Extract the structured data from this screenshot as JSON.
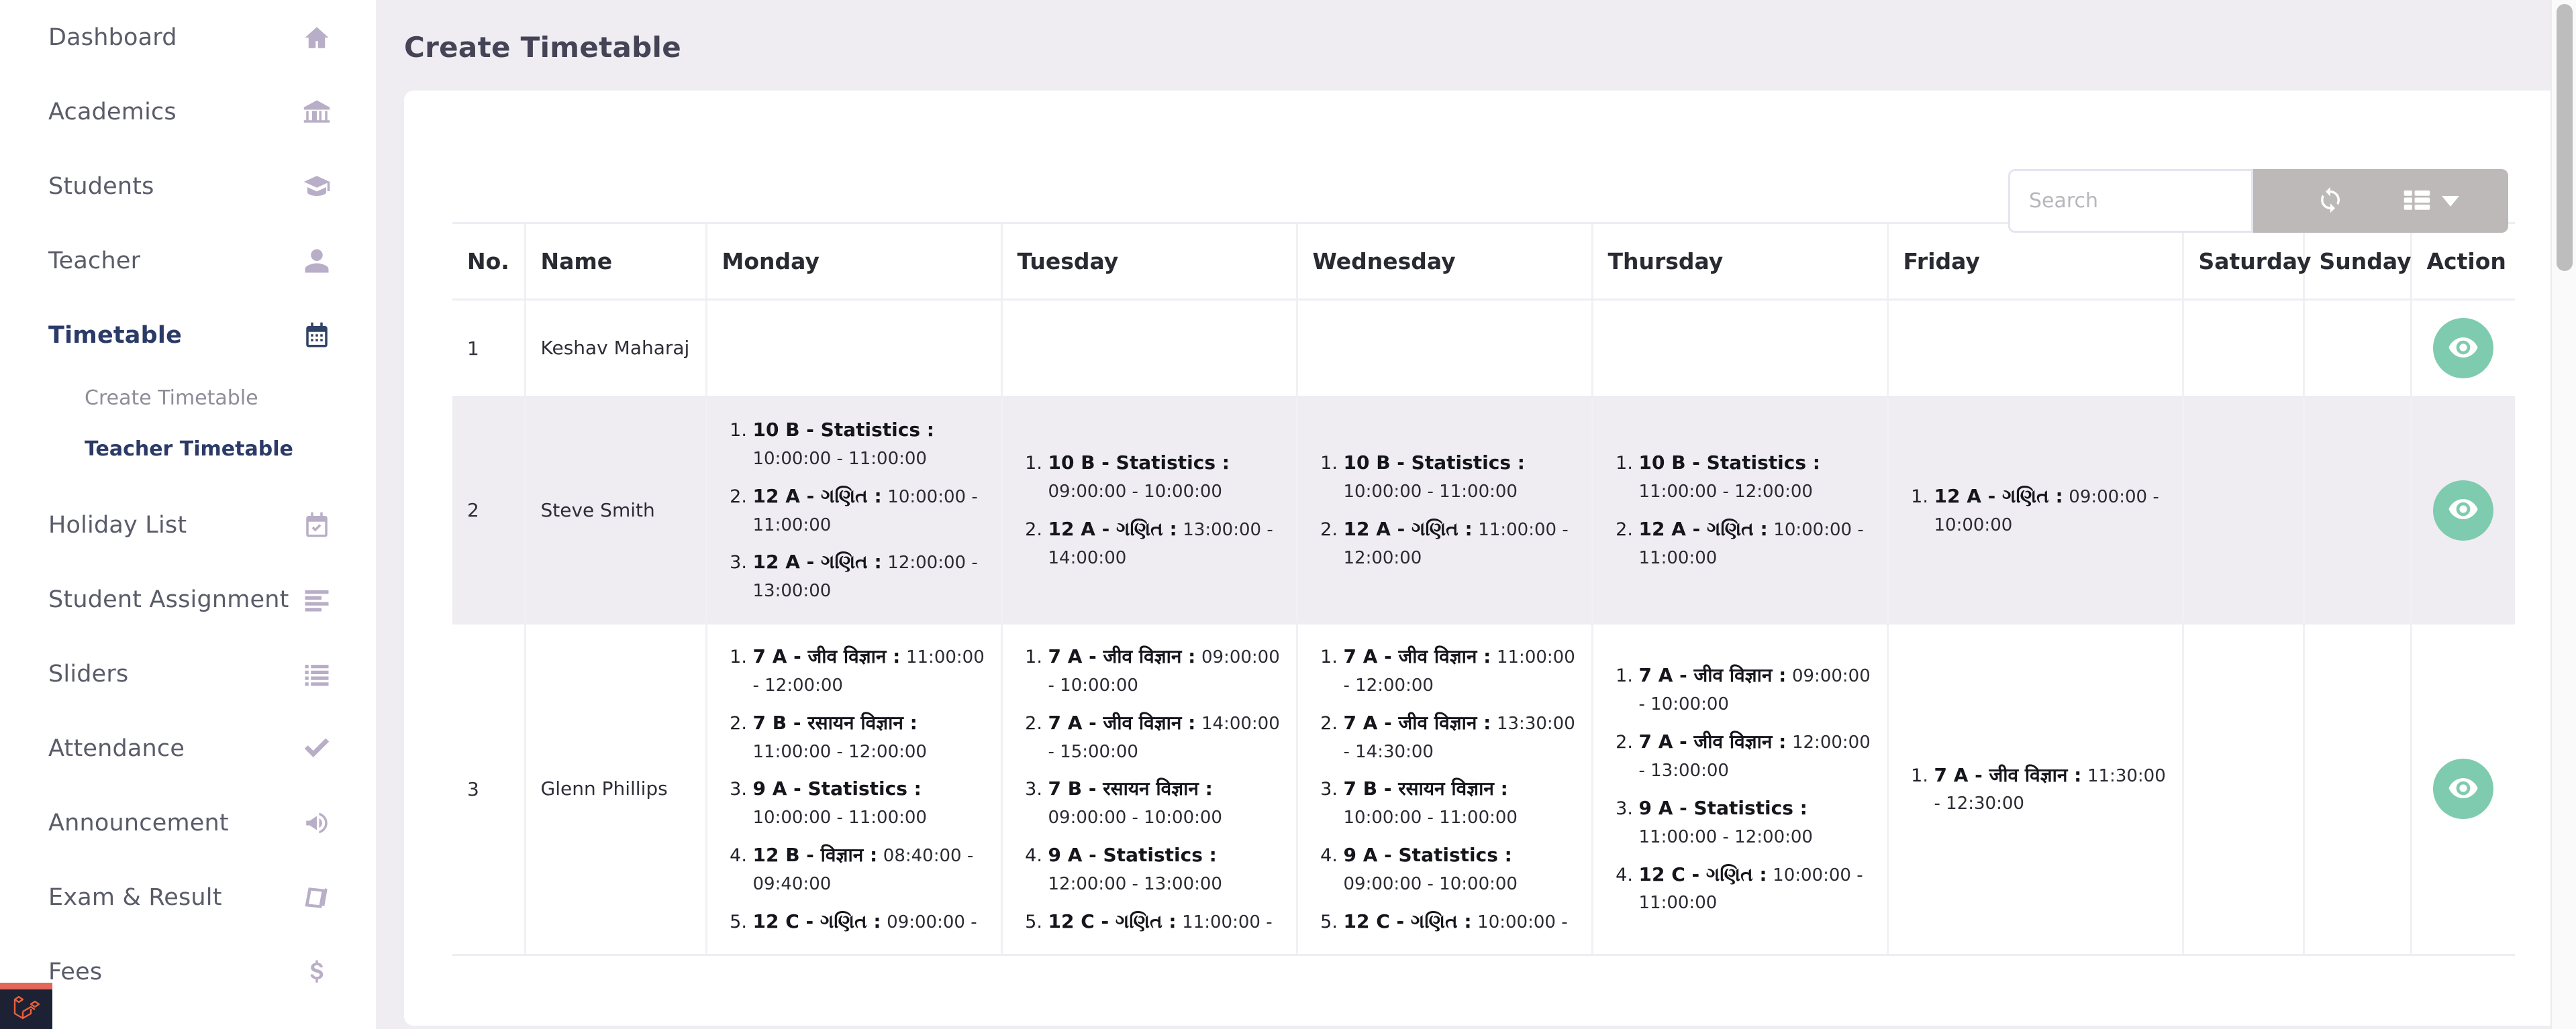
{
  "sidebar": {
    "items": [
      {
        "label": "Dashboard",
        "icon": "home-icon",
        "active": false
      },
      {
        "label": "Academics",
        "icon": "bank-icon",
        "active": false
      },
      {
        "label": "Students",
        "icon": "graduation-icon",
        "active": false
      },
      {
        "label": "Teacher",
        "icon": "user-icon",
        "active": false
      },
      {
        "label": "Timetable",
        "icon": "calendar-icon",
        "active": true
      },
      {
        "label": "Holiday List",
        "icon": "calendar-check-icon",
        "active": false
      },
      {
        "label": "Student Assignment",
        "icon": "list-lines-icon",
        "active": false
      },
      {
        "label": "Sliders",
        "icon": "list-ul-icon",
        "active": false
      },
      {
        "label": "Attendance",
        "icon": "check-icon",
        "active": false
      },
      {
        "label": "Announcement",
        "icon": "megaphone-icon",
        "active": false
      },
      {
        "label": "Exam & Result",
        "icon": "book-icon",
        "active": false
      },
      {
        "label": "Fees",
        "icon": "dollar-icon",
        "active": false
      }
    ],
    "subitems": [
      {
        "label": "Create Timetable",
        "active": false
      },
      {
        "label": "Teacher Timetable",
        "active": true
      }
    ],
    "debugbar_icon": "laravel-logo-icon"
  },
  "header": {
    "title": "Create Timetable"
  },
  "toolbar": {
    "search_placeholder": "Search",
    "search_value": "",
    "refresh_icon": "refresh-icon",
    "columns_icon": "columns-icon",
    "caret_icon": "chevron-down-icon"
  },
  "table": {
    "columns": [
      "No.",
      "Name",
      "Monday",
      "Tuesday",
      "Wednesday",
      "Thursday",
      "Friday",
      "Saturday",
      "Sunday",
      "Action"
    ],
    "action_icon": "eye-icon",
    "rows": [
      {
        "no": "1",
        "name": "Keshav Maharaj",
        "zebra": false,
        "monday": [],
        "tuesday": [],
        "wednesday": [],
        "thursday": [],
        "friday": [],
        "saturday": [],
        "sunday": []
      },
      {
        "no": "2",
        "name": "Steve Smith",
        "zebra": true,
        "monday": [
          {
            "subject": "10 B - Statistics :",
            "time": "10:00:00 - 11:00:00"
          },
          {
            "subject": "12 A - ગણિત :",
            "time": "10:00:00 - 11:00:00"
          },
          {
            "subject": "12 A - ગણિત :",
            "time": "12:00:00 - 13:00:00"
          }
        ],
        "tuesday": [
          {
            "subject": "10 B - Statistics :",
            "time": "09:00:00 - 10:00:00"
          },
          {
            "subject": "12 A - ગણિત :",
            "time": "13:00:00 - 14:00:00"
          }
        ],
        "wednesday": [
          {
            "subject": "10 B - Statistics :",
            "time": "10:00:00 - 11:00:00"
          },
          {
            "subject": "12 A - ગણિત :",
            "time": "11:00:00 - 12:00:00"
          }
        ],
        "thursday": [
          {
            "subject": "10 B - Statistics :",
            "time": "11:00:00 - 12:00:00"
          },
          {
            "subject": "12 A - ગણિત :",
            "time": "10:00:00 - 11:00:00"
          }
        ],
        "friday": [
          {
            "subject": "12 A - ગણિત :",
            "time": "09:00:00 - 10:00:00"
          }
        ],
        "saturday": [],
        "sunday": []
      },
      {
        "no": "3",
        "name": "Glenn Phillips",
        "zebra": false,
        "monday": [
          {
            "subject": "7 A - जीव विज्ञान :",
            "time": "11:00:00 - 12:00:00"
          },
          {
            "subject": "7 B - रसायन विज्ञान :",
            "time": "11:00:00 - 12:00:00"
          },
          {
            "subject": "9 A - Statistics :",
            "time": "10:00:00 - 11:00:00"
          },
          {
            "subject": "12 B - विज्ञान :",
            "time": "08:40:00 - 09:40:00"
          },
          {
            "subject": "12 C - ગણિત :",
            "time": "09:00:00 -"
          }
        ],
        "tuesday": [
          {
            "subject": "7 A - जीव विज्ञान :",
            "time": "09:00:00 - 10:00:00"
          },
          {
            "subject": "7 A - जीव विज्ञान :",
            "time": "14:00:00 - 15:00:00"
          },
          {
            "subject": "7 B - रसायन विज्ञान :",
            "time": "09:00:00 - 10:00:00"
          },
          {
            "subject": "9 A - Statistics :",
            "time": "12:00:00 - 13:00:00"
          },
          {
            "subject": "12 C - ગણિત :",
            "time": "11:00:00 -"
          }
        ],
        "wednesday": [
          {
            "subject": "7 A - जीव विज्ञान :",
            "time": "11:00:00 - 12:00:00"
          },
          {
            "subject": "7 A - जीव विज्ञान :",
            "time": "13:30:00 - 14:30:00"
          },
          {
            "subject": "7 B - रसायन विज्ञान :",
            "time": "10:00:00 - 11:00:00"
          },
          {
            "subject": "9 A - Statistics :",
            "time": "09:00:00 - 10:00:00"
          },
          {
            "subject": "12 C - ગણિત :",
            "time": "10:00:00 -"
          }
        ],
        "thursday": [
          {
            "subject": "7 A - जीव विज्ञान :",
            "time": "09:00:00 - 10:00:00"
          },
          {
            "subject": "7 A - जीव विज्ञान :",
            "time": "12:00:00 - 13:00:00"
          },
          {
            "subject": "9 A - Statistics :",
            "time": "11:00:00 - 12:00:00"
          },
          {
            "subject": "12 C - ગણિત :",
            "time": "10:00:00 - 11:00:00"
          }
        ],
        "friday": [
          {
            "subject": "7 A - जीव विज्ञान :",
            "time": "11:30:00 - 12:30:00"
          }
        ],
        "saturday": [],
        "sunday": []
      }
    ]
  },
  "colors": {
    "accent_green": "#7ecbb0",
    "sidebar_active": "#2b3a67",
    "page_bg": "#efedf2",
    "toolbar_gray": "#bdb9b9"
  }
}
